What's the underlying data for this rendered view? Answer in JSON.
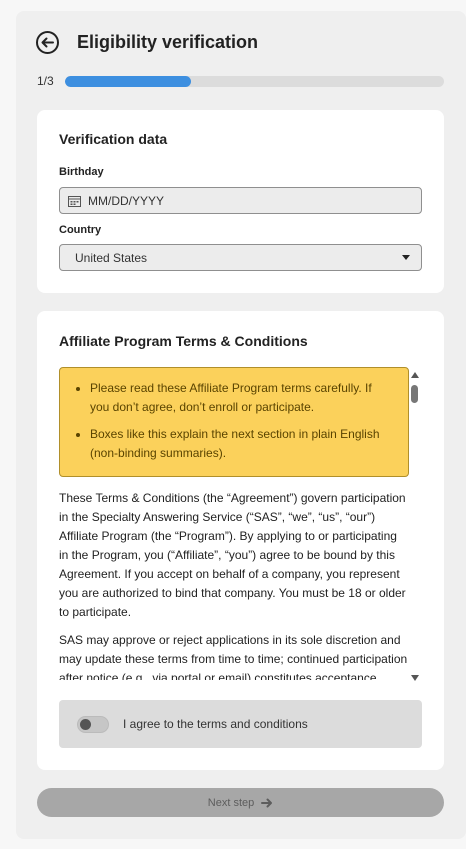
{
  "header": {
    "title": "Eligibility verification",
    "back_icon": "arrow-left-circle-icon"
  },
  "progress": {
    "label": "1/3",
    "fraction": 0.333
  },
  "verification": {
    "title": "Verification data",
    "birthday_label": "Birthday",
    "birthday_placeholder": "MM/DD/YYYY",
    "country_label": "Country",
    "country_value": "United States"
  },
  "terms": {
    "title": "Affiliate Program Terms & Conditions",
    "notes": [
      "Please read these Affiliate Program terms carefully. If you don’t agree, don’t enroll or participate.",
      "Boxes like this explain the next section in plain English (non-binding summaries)."
    ],
    "paragraphs": [
      "These Terms & Conditions (the “Agreement”) govern participation in the Specialty Answering Service (“SAS”, “we”, “us”, “our”) Affiliate Program (the “Program”). By applying to or participating in the Program, you (“Affiliate”, “you”) agree to be bound by this Agreement. If you accept on behalf of a company, you represent you are authorized to bind that company. You must be 18 or older to participate.",
      "SAS may approve or reject applications in its sole discretion and may update these terms from time to time; continued participation after notice (e.g., via portal or email) constitutes acceptance."
    ],
    "agree_label": "I agree to the terms and conditions",
    "agree_checked": false
  },
  "footer": {
    "next_label": "Next step",
    "next_icon": "arrow-right-icon"
  },
  "colors": {
    "accent": "#3d8fe0",
    "note_bg": "#fbd15b",
    "button_disabled": "#a7a7a7"
  }
}
